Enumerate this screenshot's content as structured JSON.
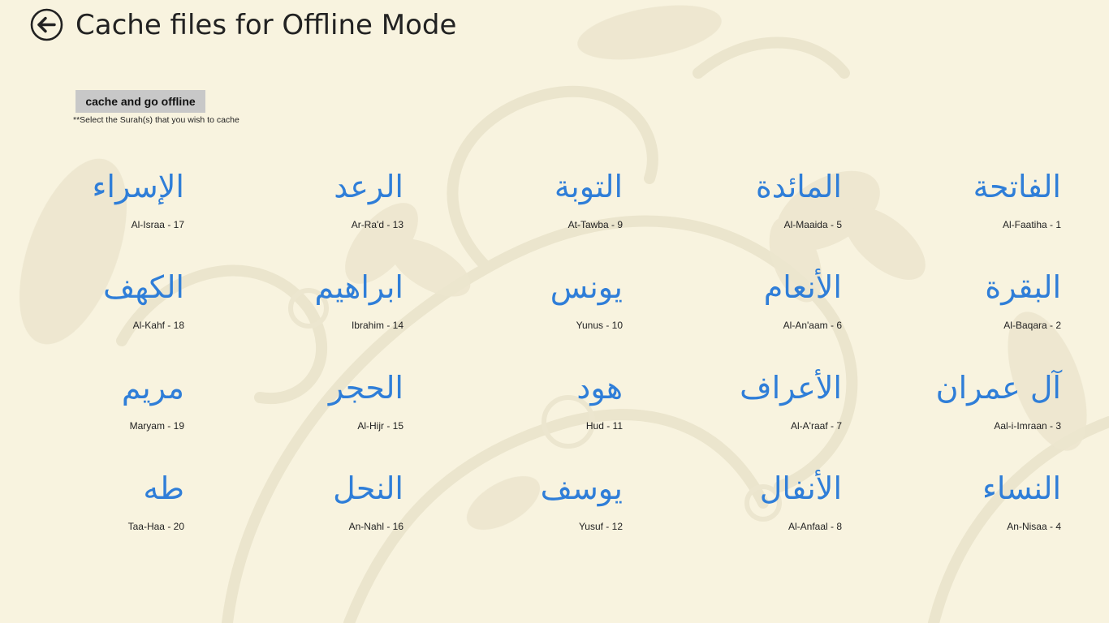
{
  "header": {
    "back_icon": "back-arrow-icon",
    "title": "Cache files for Offline Mode"
  },
  "actions": {
    "cache_button_label": "cache and go offline",
    "hint": "**Select the Surah(s) that you wish to cache"
  },
  "colors": {
    "background": "#f8f3df",
    "accent_arabic": "#2f7ed8",
    "button_bg": "#c8c8c8"
  },
  "surahs": [
    {
      "arabic": "الفاتحة",
      "label": "Al-Faatiha - 1"
    },
    {
      "arabic": "البقرة",
      "label": "Al-Baqara - 2"
    },
    {
      "arabic": "آل عمران",
      "label": "Aal-i-Imraan - 3"
    },
    {
      "arabic": "النساء",
      "label": "An-Nisaa - 4"
    },
    {
      "arabic": "المائدة",
      "label": "Al-Maaida - 5"
    },
    {
      "arabic": "الأنعام",
      "label": "Al-An'aam - 6"
    },
    {
      "arabic": "الأعراف",
      "label": "Al-A'raaf - 7"
    },
    {
      "arabic": "الأنفال",
      "label": "Al-Anfaal - 8"
    },
    {
      "arabic": "التوبة",
      "label": "At-Tawba - 9"
    },
    {
      "arabic": "يونس",
      "label": "Yunus - 10"
    },
    {
      "arabic": "هود",
      "label": "Hud - 11"
    },
    {
      "arabic": "يوسف",
      "label": "Yusuf - 12"
    },
    {
      "arabic": "الرعد",
      "label": "Ar-Ra'd - 13"
    },
    {
      "arabic": "ابراهيم",
      "label": "Ibrahim - 14"
    },
    {
      "arabic": "الحجر",
      "label": "Al-Hijr - 15"
    },
    {
      "arabic": "النحل",
      "label": "An-Nahl - 16"
    },
    {
      "arabic": "الإسراء",
      "label": "Al-Israa - 17"
    },
    {
      "arabic": "الكهف",
      "label": "Al-Kahf - 18"
    },
    {
      "arabic": "مريم",
      "label": "Maryam - 19"
    },
    {
      "arabic": "طه",
      "label": "Taa-Haa - 20"
    }
  ]
}
